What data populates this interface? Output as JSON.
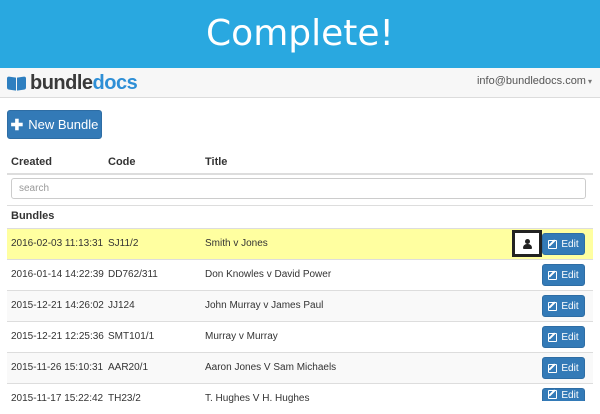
{
  "banner": {
    "text": "Complete!"
  },
  "navbar": {
    "logo": {
      "part1": "bundle",
      "part2": "docs"
    },
    "user_email": "info@bundledocs.com",
    "colors": {
      "banner": "#29a8e0",
      "primary": "#337ab7",
      "highlight": "#ffffa0"
    }
  },
  "toolbar": {
    "new_bundle_label": "New Bundle",
    "new_bundle_icon": "plus-icon"
  },
  "table": {
    "headers": {
      "created": "Created",
      "code": "Code",
      "title": "Title"
    },
    "search_placeholder": "search",
    "section_label": "Bundles",
    "edit_label": "Edit",
    "rows": [
      {
        "created": "2016-02-03 11:13:31",
        "code": "SJ11/2",
        "title": "Smith v Jones",
        "highlighted": true,
        "user_icon": "user-icon"
      },
      {
        "created": "2016-01-14 14:22:39",
        "code": "DD762/311",
        "title": "Don Knowles v David Power"
      },
      {
        "created": "2015-12-21 14:26:02",
        "code": "JJ124",
        "title": "John Murray v James Paul"
      },
      {
        "created": "2015-12-21 12:25:36",
        "code": "SMT101/1",
        "title": "Murray v Murray"
      },
      {
        "created": "2015-11-26 15:10:31",
        "code": "AAR20/1",
        "title": "Aaron Jones V Sam Michaels"
      },
      {
        "created": "2015-11-17 15:22:42",
        "code": "TH23/2",
        "title": "T. Hughes V H. Hughes"
      }
    ]
  }
}
